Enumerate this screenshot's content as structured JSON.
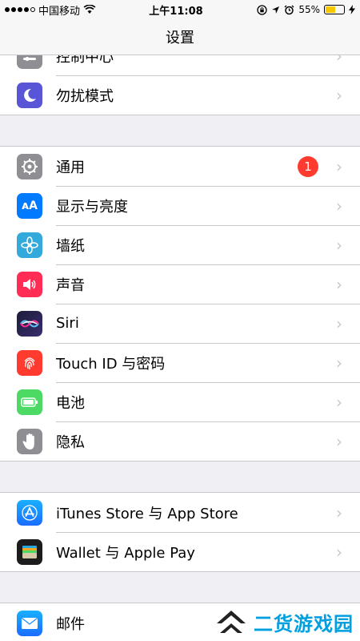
{
  "status": {
    "carrier": "中国移动",
    "time": "上午11:08",
    "battery": "55%",
    "battery_level": 0.55
  },
  "nav": {
    "title": "设置"
  },
  "groups": [
    {
      "items": [
        {
          "label": "控制中心",
          "icon": "control-center-icon",
          "color": "#8e8e93"
        },
        {
          "label": "勿扰模式",
          "icon": "moon-icon",
          "color": "#5856d6"
        }
      ]
    },
    {
      "items": [
        {
          "label": "通用",
          "icon": "gear-icon",
          "color": "#8e8e93",
          "badge": "1"
        },
        {
          "label": "显示与亮度",
          "icon": "display-icon",
          "color": "#007aff"
        },
        {
          "label": "墙纸",
          "icon": "wallpaper-icon",
          "color": "#34aadc"
        },
        {
          "label": "声音",
          "icon": "speaker-icon",
          "color": "#ff2d55"
        },
        {
          "label": "Siri",
          "icon": "siri-icon",
          "color": "#1c1c3a"
        },
        {
          "label": "Touch ID 与密码",
          "icon": "fingerprint-icon",
          "color": "#ff3b30"
        },
        {
          "label": "电池",
          "icon": "battery-icon",
          "color": "#4cd964"
        },
        {
          "label": "隐私",
          "icon": "hand-icon",
          "color": "#8e8e93"
        }
      ]
    },
    {
      "items": [
        {
          "label": "iTunes Store 与 App Store",
          "icon": "app-store-icon",
          "color": "#1a8cff"
        },
        {
          "label": "Wallet 与 Apple Pay",
          "icon": "wallet-icon",
          "color": "#1c1c1c"
        }
      ]
    },
    {
      "items": [
        {
          "label": "邮件",
          "icon": "mail-icon",
          "color": "#1a8cff"
        }
      ]
    }
  ],
  "watermark": {
    "text": "二货游戏园"
  }
}
